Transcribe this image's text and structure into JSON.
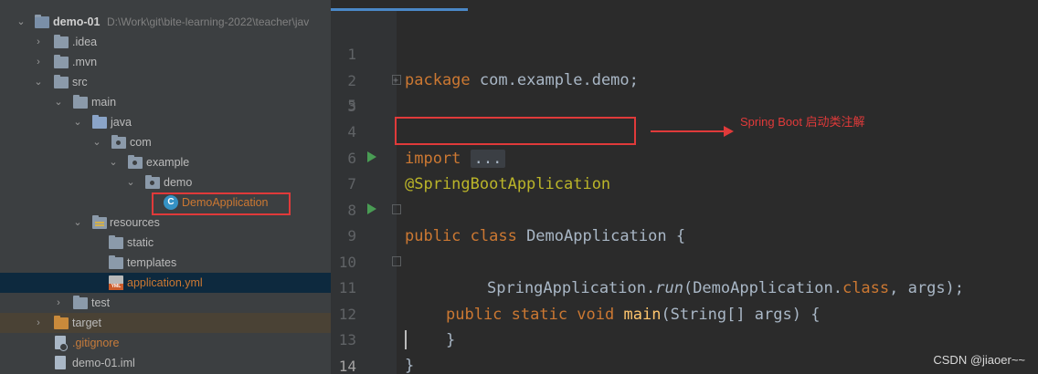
{
  "project_tree": {
    "root": {
      "name": "demo-01",
      "path": "D:\\Work\\git\\bite-learning-2022\\teacher\\jav"
    },
    "items": [
      {
        "label": ".idea"
      },
      {
        "label": ".mvn"
      },
      {
        "label": "src"
      },
      {
        "label": "main"
      },
      {
        "label": "java"
      },
      {
        "label": "com"
      },
      {
        "label": "example"
      },
      {
        "label": "demo"
      },
      {
        "label": "DemoApplication"
      },
      {
        "label": "resources"
      },
      {
        "label": "static"
      },
      {
        "label": "templates"
      },
      {
        "label": "application.yml"
      },
      {
        "label": "test"
      },
      {
        "label": "target"
      },
      {
        "label": ".gitignore"
      },
      {
        "label": "demo-01.iml"
      }
    ]
  },
  "editor": {
    "line_numbers": [
      "1",
      "2",
      "3",
      "4",
      "5",
      "6",
      "7",
      "8",
      "9",
      "10",
      "11",
      "12",
      "13",
      "14"
    ],
    "code": {
      "l1_kw": "package",
      "l1_rest": " com.example.demo;",
      "l3_kw": "import",
      "l3_dots": "...",
      "l6_ann": "@SpringBootApplication",
      "l7_kw": "public class",
      "l7_rest": " DemoApplication {",
      "l9_kw": "public static void",
      "l9_fn": "main",
      "l9_rest": "(String[] args) {",
      "l10_a": "SpringApplication.",
      "l10_run": "run",
      "l10_b": "(DemoApplication.",
      "l10_class": "class",
      "l10_c": ", args);",
      "l11": "}",
      "l13": "}"
    }
  },
  "annotation": {
    "text": "Spring Boot 启动类注解"
  },
  "watermark": "CSDN @jiaoer~~",
  "colors": {
    "highlight": "#e03a3a",
    "annotation_yellow": "#bbb529",
    "keyword": "#cc7832",
    "run_green": "#499c54"
  }
}
